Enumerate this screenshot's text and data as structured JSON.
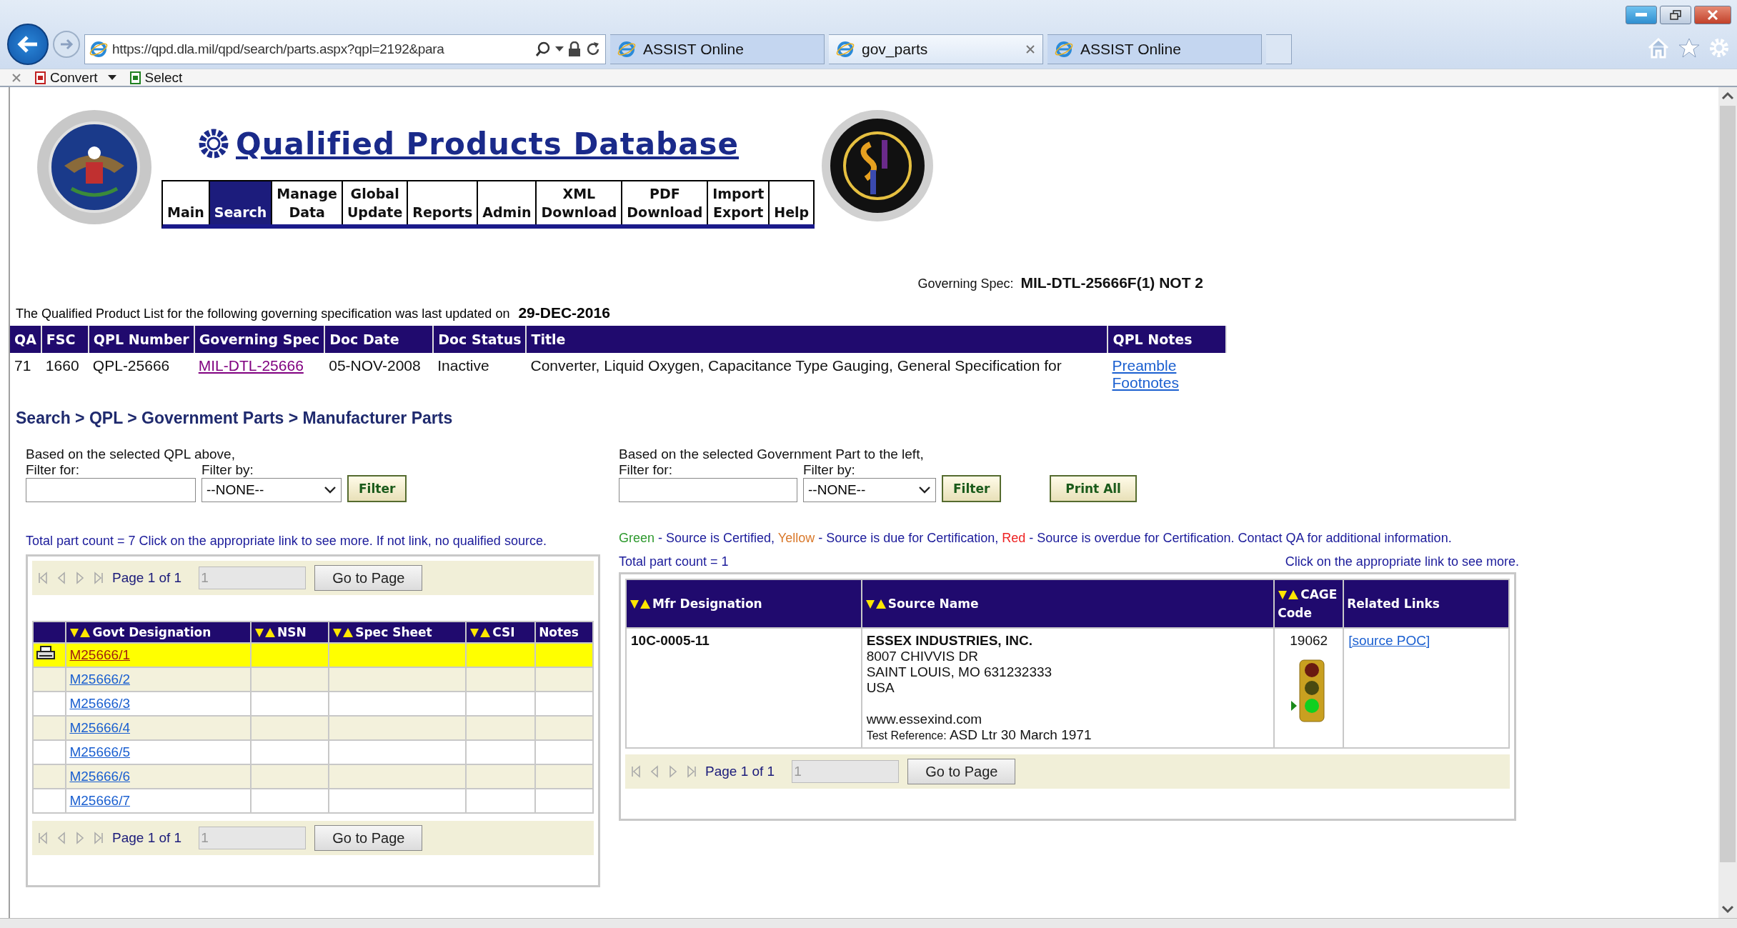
{
  "browser": {
    "address": "https://qpd.dla.mil/qpd/search/parts.aspx?qpl=2192&para",
    "tabs": [
      {
        "title": "ASSIST Online",
        "selected": false,
        "closable": false
      },
      {
        "title": "gov_parts",
        "selected": true,
        "closable": true
      },
      {
        "title": "ASSIST Online",
        "selected": false,
        "closable": false
      }
    ],
    "toolbar": [
      {
        "label": "Convert",
        "kind": "menu"
      },
      {
        "label": "Select",
        "kind": "plain"
      }
    ]
  },
  "header": {
    "logo_text": "Qualified Products Database",
    "nav": [
      {
        "lines": [
          "Main"
        ],
        "selected": false
      },
      {
        "lines": [
          "Search"
        ],
        "selected": true
      },
      {
        "lines": [
          "Manage",
          "Data"
        ],
        "selected": false
      },
      {
        "lines": [
          "Global",
          "Update"
        ],
        "selected": false
      },
      {
        "lines": [
          "Reports"
        ],
        "selected": false
      },
      {
        "lines": [
          "Admin"
        ],
        "selected": false
      },
      {
        "lines": [
          "XML",
          "Download"
        ],
        "selected": false
      },
      {
        "lines": [
          "PDF",
          "Download"
        ],
        "selected": false
      },
      {
        "lines": [
          "Import",
          "Export"
        ],
        "selected": false
      },
      {
        "lines": [
          "Help"
        ],
        "selected": false
      }
    ]
  },
  "governing_spec": {
    "label": "Governing Spec:",
    "value": "MIL-DTL-25666F(1) NOT 2"
  },
  "update_notice": {
    "text": "The Qualified Product List for the following governing specification was last updated on",
    "date": "29-DEC-2016"
  },
  "qpl_table": {
    "columns": [
      "QA",
      "FSC",
      "QPL Number",
      "Governing Spec",
      "Doc Date",
      "Doc Status",
      "Title",
      "QPL Notes"
    ],
    "rows": [
      {
        "qa": "71",
        "fsc": "1660",
        "qpl_number": "QPL-25666",
        "governing_spec": "MIL-DTL-25666",
        "doc_date": "05-NOV-2008",
        "doc_status": "Inactive",
        "title": "Converter, Liquid Oxygen, Capacitance Type Gauging, General Specification for",
        "notes": [
          "Preamble",
          "Footnotes"
        ]
      }
    ]
  },
  "breadcrumb": "Search > QPL > Government Parts > Manufacturer Parts",
  "left": {
    "filter": {
      "intro": "Based on the selected QPL above,",
      "filter_for": "Filter for:",
      "filter_by": "Filter by:",
      "select_value": "--NONE--",
      "button": "Filter"
    },
    "summary": "Total part count = 7  Click on the appropriate link to see more. If not link, no qualified source.",
    "pager_top": {
      "page_text": "Page 1 of 1",
      "page_value": "1",
      "button": "Go to Page"
    },
    "columns": [
      {
        "sortable": false
      },
      {
        "label": "Govt Designation",
        "sortable": true
      },
      {
        "label": "NSN",
        "sortable": true
      },
      {
        "label": "Spec Sheet",
        "sortable": true
      },
      {
        "label": "CSI",
        "sortable": true
      },
      {
        "label": "Notes",
        "sortable": false
      }
    ],
    "rows": [
      {
        "designation": "M25666/1",
        "selected": true
      },
      {
        "designation": "M25666/2",
        "selected": false
      },
      {
        "designation": "M25666/3",
        "selected": false
      },
      {
        "designation": "M25666/4",
        "selected": false
      },
      {
        "designation": "M25666/5",
        "selected": false
      },
      {
        "designation": "M25666/6",
        "selected": false
      },
      {
        "designation": "M25666/7",
        "selected": false
      }
    ],
    "pager_bottom": {
      "page_text": "Page 1 of 1",
      "page_value": "1",
      "button": "Go to Page"
    }
  },
  "right": {
    "filter": {
      "intro": "Based on the selected Government Part to the left,",
      "filter_for": "Filter for:",
      "filter_by": "Filter by:",
      "select_value": "--NONE--",
      "button": "Filter",
      "print_button": "Print All"
    },
    "legend": [
      {
        "label": "Green",
        "color": "#2e9a2e",
        "description": "- Source is Certified,"
      },
      {
        "label": "Yellow",
        "color": "#d9782a",
        "description": "- Source is due for Certification,"
      },
      {
        "label": "Red",
        "color": "#ee2222",
        "description": "- Source is overdue for Certification. Contact QA for additional information."
      }
    ],
    "count": "Total part count = 1",
    "hint": "Click on the appropriate link to see more.",
    "columns": [
      {
        "label": "Mfr Designation",
        "sortable": true
      },
      {
        "label": "Source Name",
        "sortable": true
      },
      {
        "label": "CAGE Code",
        "sortable": true
      },
      {
        "label": "Related Links",
        "sortable": false
      }
    ],
    "rows": [
      {
        "mfr_designation": "10C-0005-11",
        "source_name": "ESSEX INDUSTRIES, INC.",
        "address_lines": [
          "8007 CHIVVIS DR",
          "SAINT LOUIS, MO 631232333",
          "USA"
        ],
        "website": "www.essexind.com",
        "test_reference_label": "Test Reference:",
        "test_reference": "ASD Ltr 30 March 1971",
        "cage_code": "19062",
        "signal": {
          "red": false,
          "yellow": false,
          "green": true
        },
        "link": "[source POC]"
      }
    ],
    "pager": {
      "page_text": "Page 1 of 1",
      "page_value": "1",
      "button": "Go to Page"
    }
  }
}
